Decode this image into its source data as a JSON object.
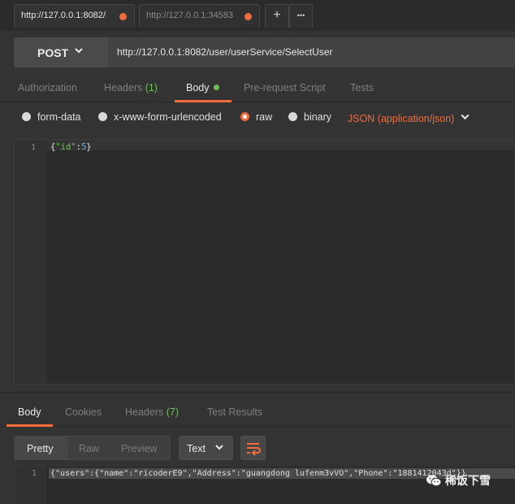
{
  "tabs": [
    {
      "label": "http://127.0.0.1:8082/",
      "active": true
    },
    {
      "label": "http://127.0.0.1:34583",
      "active": false
    }
  ],
  "tab_controls": {
    "add": "+",
    "more": "•••"
  },
  "request": {
    "method": "POST",
    "url": "http://127.0.0.1:8082/user/userService/SelectUser"
  },
  "request_tabs": {
    "authorization": "Authorization",
    "headers": "Headers",
    "headers_count": "(1)",
    "body": "Body",
    "prerequest": "Pre-request Script",
    "tests": "Tests"
  },
  "body_options": {
    "form_data": "form-data",
    "urlencoded": "x-www-form-urlencoded",
    "raw": "raw",
    "binary": "binary",
    "content_type": "JSON (application/json)"
  },
  "request_editor": {
    "line_number": "1",
    "open": "{",
    "key": "\"id\"",
    "colon": ":",
    "value": "5",
    "close": "}"
  },
  "response_tabs": {
    "body": "Body",
    "cookies": "Cookies",
    "headers": "Headers",
    "headers_count": "(7)",
    "test_results": "Test Results"
  },
  "view_modes": {
    "pretty": "Pretty",
    "raw": "Raw",
    "preview": "Preview"
  },
  "format_select": "Text",
  "response_editor": {
    "line_number": "1",
    "content": "{\"users\":{\"name\":\"ricoderE9\",\"Address\":\"guangdong lufenm3vVO\",\"Phone\":\"1881412043d\"}}"
  },
  "watermark": "稀饭下雪",
  "colors": {
    "accent": "#f26b3a",
    "success": "#6fbf56",
    "background": "#333333"
  }
}
